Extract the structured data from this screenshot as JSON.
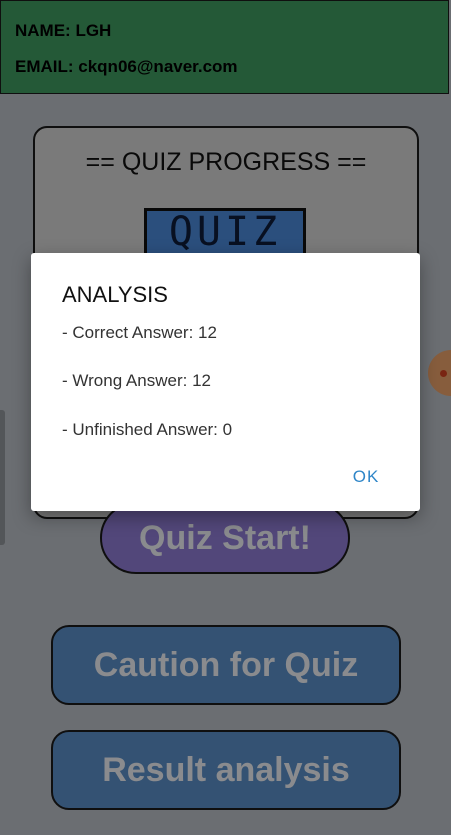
{
  "header": {
    "name_line": "NAME: LGH",
    "email_line": "EMAIL: ckqn06@naver.com"
  },
  "card": {
    "title": "== QUIZ PROGRESS ==",
    "logo_text": "QUIZ"
  },
  "buttons": {
    "start": "Quiz Start!",
    "caution": "Caution for Quiz",
    "result": "Result analysis"
  },
  "dialog": {
    "title": "ANALYSIS",
    "correct": "- Correct Answer: 12",
    "wrong": "- Wrong Answer: 12",
    "unfinished": "- Unfinished Answer: 0",
    "ok": "OK"
  },
  "colors": {
    "header_bg": "#3f9960",
    "start_button": "#8e7ad2",
    "nav_button": "#5b8ec6",
    "accent": "#2f86c8"
  }
}
